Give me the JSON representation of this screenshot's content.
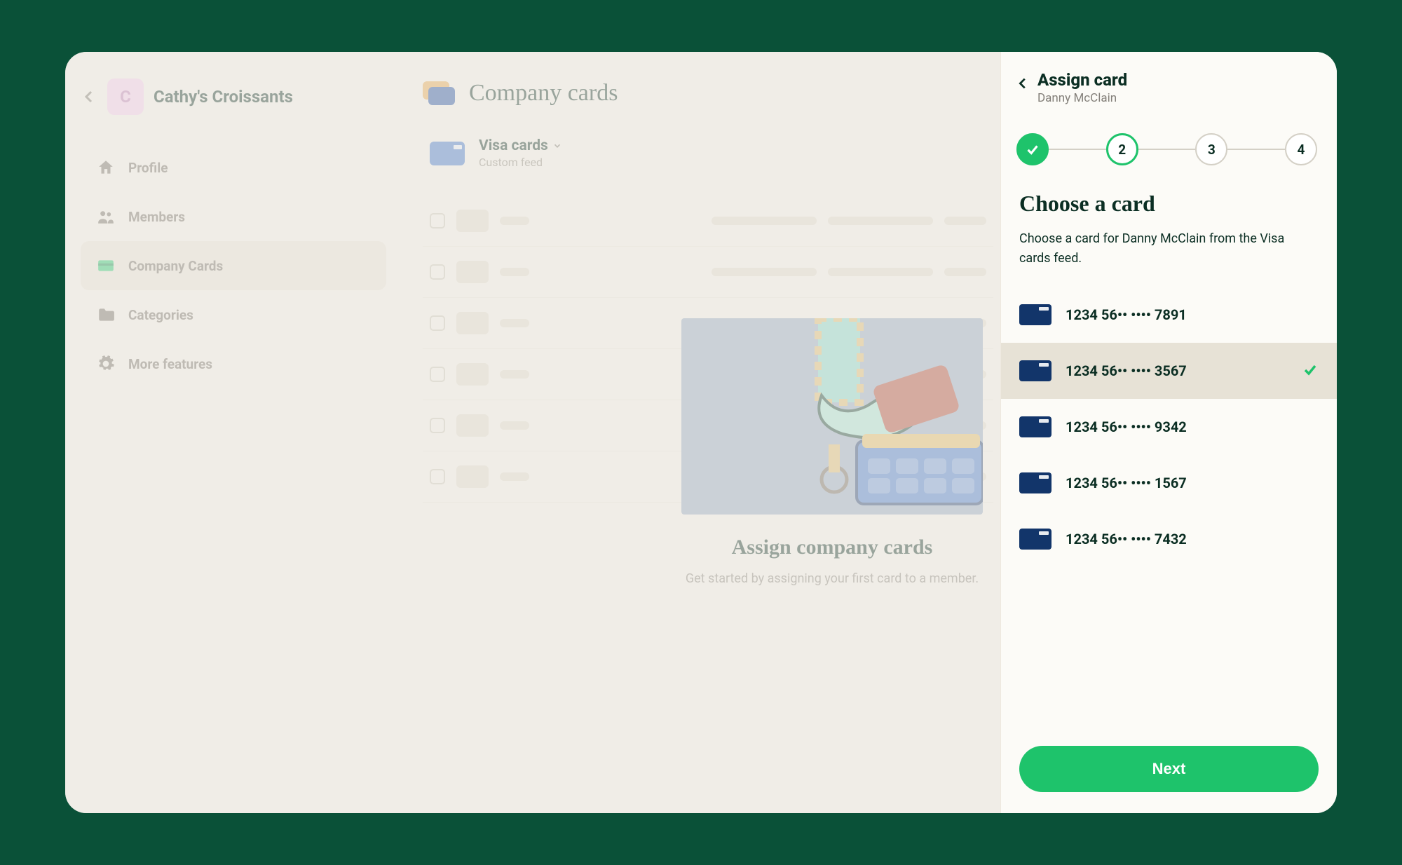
{
  "workspace": {
    "back_icon": "chevron-left",
    "avatar_letter": "C",
    "name": "Cathy's Croissants"
  },
  "sidebar": {
    "items": [
      {
        "id": "profile",
        "label": "Profile",
        "icon": "home",
        "active": false
      },
      {
        "id": "members",
        "label": "Members",
        "icon": "people",
        "active": false
      },
      {
        "id": "company-cards",
        "label": "Company Cards",
        "icon": "card",
        "active": true
      },
      {
        "id": "categories",
        "label": "Categories",
        "icon": "folder",
        "active": false
      },
      {
        "id": "more",
        "label": "More features",
        "icon": "gear",
        "active": false
      }
    ]
  },
  "main": {
    "title": "Company cards",
    "feed": {
      "name": "Visa cards",
      "subtitle": "Custom feed"
    },
    "promo_title": "Assign company cards",
    "promo_text": "Get started by assigning your first card to a member."
  },
  "panel": {
    "title": "Assign card",
    "subtitle": "Danny McClain",
    "steps": [
      {
        "label": "",
        "state": "done"
      },
      {
        "label": "2",
        "state": "active"
      },
      {
        "label": "3",
        "state": "pending"
      },
      {
        "label": "4",
        "state": "pending"
      }
    ],
    "heading": "Choose a card",
    "description": "Choose a card for Danny McClain from the Visa cards feed.",
    "cards": [
      {
        "number": "1234 56•• •••• 7891",
        "selected": false
      },
      {
        "number": "1234 56•• •••• 3567",
        "selected": true
      },
      {
        "number": "1234 56•• •••• 9342",
        "selected": false
      },
      {
        "number": "1234 56•• •••• 1567",
        "selected": false
      },
      {
        "number": "1234 56•• •••• 7432",
        "selected": false
      }
    ],
    "next_label": "Next"
  }
}
